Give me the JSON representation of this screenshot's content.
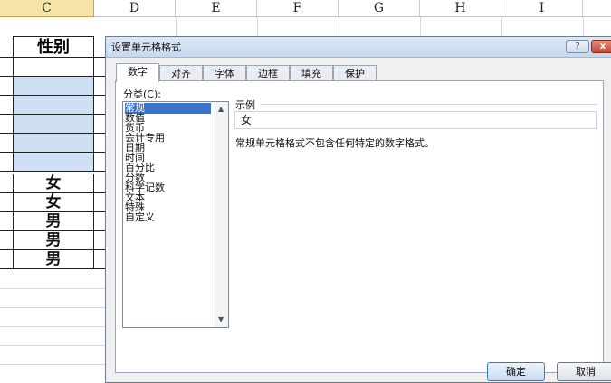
{
  "columns": [
    "C",
    "D",
    "E",
    "F",
    "G",
    "H",
    "I"
  ],
  "header_cell": "性别",
  "cells": [
    "",
    "",
    "",
    "",
    "",
    "",
    "女",
    "女",
    "男",
    "男",
    "男"
  ],
  "dialog": {
    "title": "设置单元格格式",
    "help_label": "?",
    "close_label": "x",
    "tabs": [
      "数字",
      "对齐",
      "字体",
      "边框",
      "填充",
      "保护"
    ],
    "category_label": "分类(C):",
    "categories": [
      "常规",
      "数值",
      "货币",
      "会计专用",
      "日期",
      "时间",
      "百分比",
      "分数",
      "科学记数",
      "文本",
      "特殊",
      "自定义"
    ],
    "sample_label": "示例",
    "sample_value": "女",
    "description": "常规单元格格式不包含任何特定的数字格式。",
    "ok_label": "确定",
    "cancel_label": "取消"
  },
  "colors": {
    "selection": "#3a73c9",
    "cell_highlight": "#cfe0f5",
    "column_selected": "#f6e3a6"
  }
}
